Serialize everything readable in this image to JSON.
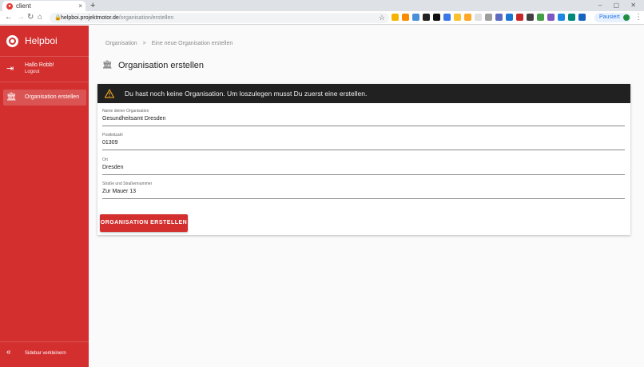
{
  "browser": {
    "tab_title": "client",
    "tab_close": "×",
    "new_tab": "+",
    "url_host": "helpboi.projektmotor.de",
    "url_path": "/organisation/erstellen",
    "profile_status": "Pausiert",
    "window_controls": "– ▢ ✕"
  },
  "sidebar": {
    "brand": "Helpboi",
    "greeting": "Hallo Robb!",
    "logout": "Logout",
    "nav_item": "Organisation erstellen",
    "collapse": "Sidebar verkleinern"
  },
  "breadcrumb": {
    "root": "Organisation",
    "separator": ">",
    "current": "Eine neue Organisation erstellen"
  },
  "page": {
    "title": "Organisation erstellen"
  },
  "alert": {
    "text": "Du hast noch keine Organisation. Um loszulegen musst Du zuerst eine erstellen."
  },
  "form": {
    "fields": [
      {
        "label": "Name deiner Organisation",
        "value": "Gesundheitsamt Dresden"
      },
      {
        "label": "Postleitzahl",
        "value": "01309"
      },
      {
        "label": "Ort",
        "value": "Dresden"
      },
      {
        "label": "Straße und Straßennummer",
        "value": "Zur Mauer 13"
      }
    ],
    "submit": "ORGANISATION ERSTELLEN"
  },
  "colors": {
    "brand": "#d32f2f",
    "alert_bg": "#212121",
    "warning": "#f9a825"
  }
}
